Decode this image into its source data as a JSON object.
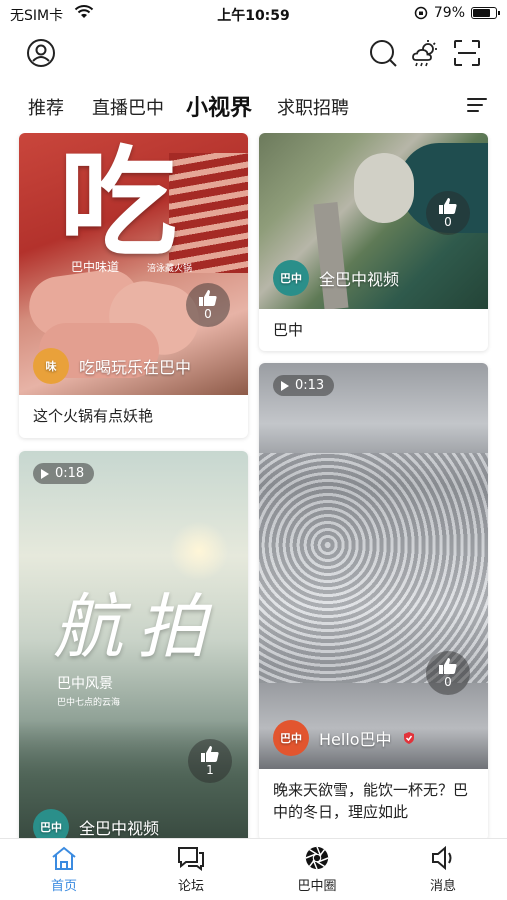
{
  "status_bar": {
    "carrier": "无SIM卡",
    "time": "上午10:59",
    "battery": "79%",
    "battery_level": 0.79
  },
  "header": {
    "profile_icon": "user-circle-icon",
    "search_icon": "search-icon",
    "weather_icon": "cloud-sun-icon",
    "scan_icon": "scan-icon"
  },
  "tabs": [
    {
      "label": "推荐"
    },
    {
      "label": "直播巴中"
    },
    {
      "label": "小视界",
      "active": true
    },
    {
      "label": "求职招聘"
    }
  ],
  "feed": {
    "left": [
      {
        "poster_big_text": "吃",
        "poster_sub": "巴中味道",
        "poster_tag": "涪泳藏火锅",
        "author": "吃喝玩乐在巴中",
        "likes": "0",
        "caption": "这个火锅有点妖艳"
      },
      {
        "duration": "0:18",
        "poster_title": "航拍",
        "poster_sub": "巴中风景",
        "poster_sub2": "巴中七点的云海",
        "author": "全巴中视频",
        "likes": "1"
      }
    ],
    "right": [
      {
        "author": "全巴中视频",
        "likes": "0",
        "caption": "巴中"
      },
      {
        "duration": "0:13",
        "author": "Hello巴中",
        "likes": "0",
        "caption": "晚来天欲雪，能饮一杯无？巴中的冬日，理应如此"
      }
    ]
  },
  "bottom_nav": [
    {
      "label": "首页",
      "icon": "home-icon",
      "active": true
    },
    {
      "label": "论坛",
      "icon": "chat-icon"
    },
    {
      "label": "巴中圈",
      "icon": "aperture-icon"
    },
    {
      "label": "消息",
      "icon": "speaker-icon"
    }
  ],
  "colors": {
    "accent": "#3b8be0",
    "tab_underline": "#8cc2f4"
  }
}
